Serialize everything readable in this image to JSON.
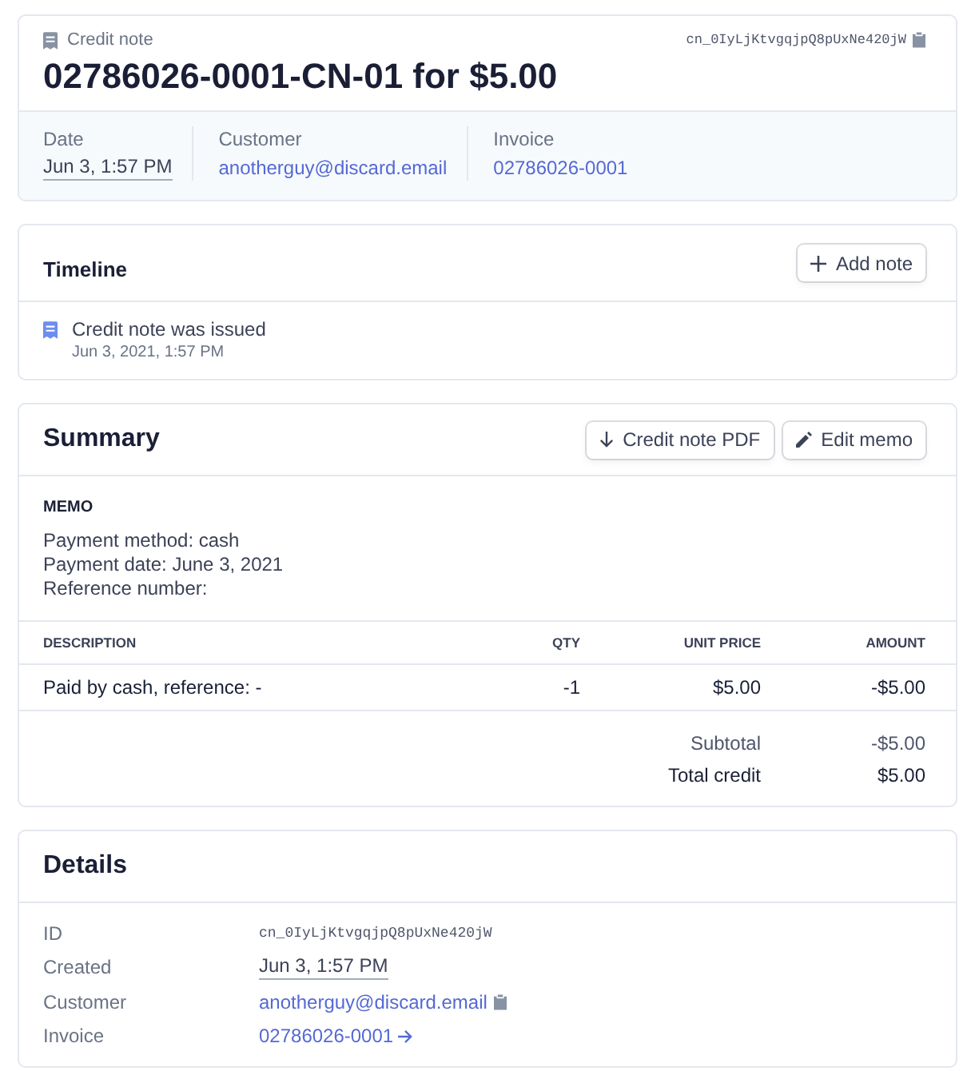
{
  "header": {
    "type_label": "Credit note",
    "id": "cn_0IyLjKtvgqjpQ8pUxNe420jW",
    "title": "02786026-0001-CN-01 for $5.00",
    "fields": [
      {
        "label": "Date",
        "value": "Jun 3, 1:57 PM",
        "kind": "date"
      },
      {
        "label": "Customer",
        "value": "anotherguy@discard.email",
        "kind": "link"
      },
      {
        "label": "Invoice",
        "value": "02786026-0001",
        "kind": "link"
      }
    ]
  },
  "timeline": {
    "title": "Timeline",
    "button": "Add note",
    "events": [
      {
        "text": "Credit note was issued",
        "time": "Jun 3, 2021, 1:57 PM"
      }
    ]
  },
  "summary": {
    "title": "Summary",
    "buttons": [
      {
        "label": "Credit note PDF",
        "kind": "download"
      },
      {
        "label": "Edit memo",
        "kind": "edit"
      }
    ],
    "memo": {
      "heading": "MEMO",
      "lines": [
        "Payment method: cash",
        "Payment date: June 3, 2021",
        "Reference number:"
      ]
    },
    "table": {
      "columns": [
        "DESCRIPTION",
        "QTY",
        "UNIT PRICE",
        "AMOUNT"
      ],
      "rows": [
        [
          "Paid by cash, reference: -",
          "-1",
          "$5.00",
          "-$5.00"
        ]
      ]
    },
    "totals": [
      {
        "label": "Subtotal",
        "value": "-$5.00",
        "emphasis": false
      },
      {
        "label": "Total credit",
        "value": "$5.00",
        "emphasis": true
      }
    ]
  },
  "details": {
    "title": "Details",
    "rows": [
      {
        "label": "ID",
        "value": "cn_0IyLjKtvgqjpQ8pUxNe420jW",
        "kind": "code"
      },
      {
        "label": "Created",
        "value": "Jun 3, 1:57 PM",
        "kind": "date"
      },
      {
        "label": "Customer",
        "value": "anotherguy@discard.email",
        "kind": "copyable"
      },
      {
        "label": "Invoice",
        "value": "02786026-0001",
        "kind": "arrowed"
      }
    ]
  }
}
